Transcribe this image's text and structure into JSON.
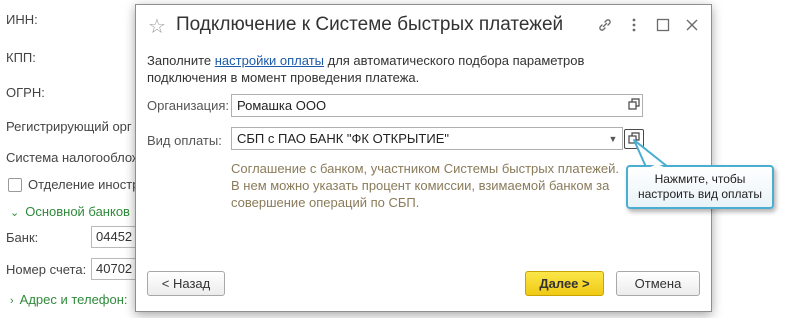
{
  "background": {
    "labels": {
      "inn": "ИНН:",
      "kpp": "КПП:",
      "ogrn": "ОГРН:",
      "registering": "Регистрирующий орг",
      "tax_system": "Система налогооблож",
      "separate_division": "Отделение иностр",
      "main_bank_group": "Основной банков",
      "bank": "Банк:",
      "account_number": "Номер счета:",
      "address_group": "Адрес и телефон:"
    },
    "values": {
      "bank": "04452",
      "account_number": "40702"
    }
  },
  "dialog": {
    "title": "Подключение к Системе быстрых платежей",
    "intro_prefix": "Заполните ",
    "intro_link": "настройки оплаты",
    "intro_suffix": " для автоматического подбора параметров подключения в момент проведения платежа.",
    "organization_label": "Организация:",
    "organization_value": "Ромашка ООО",
    "payment_type_label": "Вид оплаты:",
    "payment_type_value": "СБП с ПАО БАНК \"ФК ОТКРЫТИЕ\"",
    "hint": "Соглашение с банком, участником Системы быстрых платежей. В нем можно указать процент комиссии, взимаемой банком за совершение операций по СБП.",
    "back_button": "< Назад",
    "next_button": "Далее >",
    "cancel_button": "Отмена"
  },
  "callout": {
    "text_line1": "Нажмите, чтобы",
    "text_line2": "настроить вид оплаты"
  },
  "colors": {
    "accent_link": "#1c5aa8",
    "group_green": "#2f8a3a",
    "primary_button": "#f0c914",
    "callout_border": "#4aaed3",
    "hint_text": "#8a7b5a"
  },
  "icons": [
    "star-icon",
    "link-icon",
    "more-icon",
    "maximize-icon",
    "close-icon",
    "open-icon",
    "dropdown-icon",
    "checkbox-icon",
    "chevron-down-icon",
    "chevron-right-icon"
  ]
}
